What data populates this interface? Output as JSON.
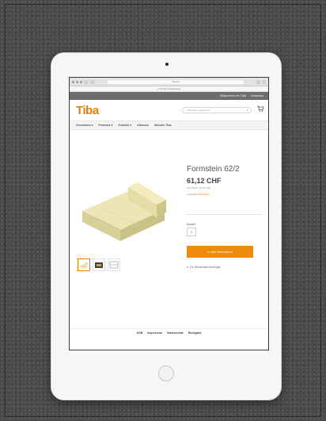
{
  "browser": {
    "url": "tiba.ch",
    "notice": "Sichere Verbindung"
  },
  "top_strip": {
    "link_1": "Willkommen bei TIBA",
    "link_2": "Anmelden"
  },
  "header": {
    "logo": "Tiba",
    "search_placeholder": "Wonach suchen Sie?"
  },
  "nav": {
    "items": [
      {
        "label": "Cheminées ▾"
      },
      {
        "label": "Produkte ▾"
      },
      {
        "label": "Zubehör ▾"
      },
      {
        "label": "Aktionen"
      },
      {
        "label": "Website Tiba"
      }
    ]
  },
  "product": {
    "title": "Formstein 62/2",
    "price": "61,12 CHF",
    "price_note": "inkl. MwSt. 86,91 CHF",
    "stock_label": "Lieferzeit",
    "stock_value": "Auf Anfrage",
    "qty_label": "Anzahl",
    "qty_value": "1",
    "cart_button": "In den Warenkorb",
    "wishlist": "Zur Wunschliste hinzufügen"
  },
  "footer": {
    "links": [
      {
        "label": "AGB"
      },
      {
        "label": "Impressum"
      },
      {
        "label": "Datenschutz"
      },
      {
        "label": "Rückgabe"
      }
    ]
  },
  "colors": {
    "brand": "#ee7d00",
    "button": "#f08a0a",
    "background": "#4a4a4a"
  }
}
